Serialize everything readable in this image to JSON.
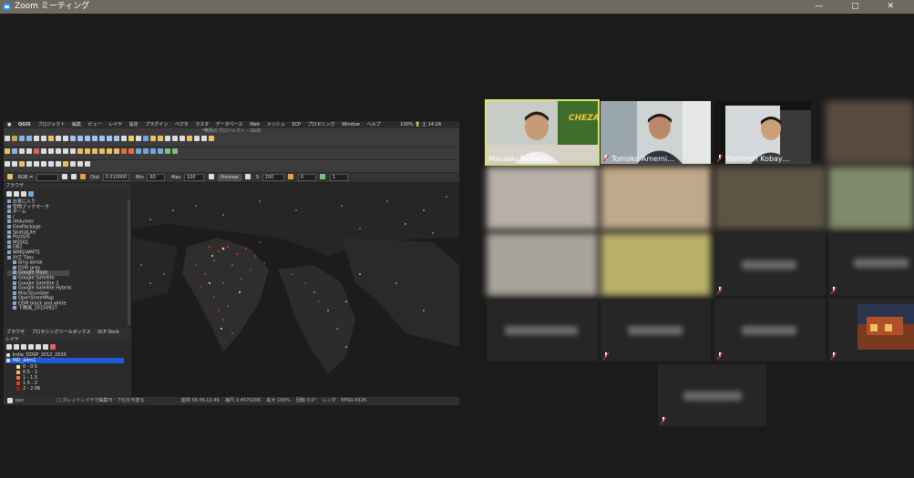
{
  "window": {
    "title": "Zoom ミーティング",
    "buttons": "— ▢ ✕"
  },
  "qgis": {
    "menu": [
      "QGIS",
      "プロジェクト",
      "編集",
      "ビュー",
      "レイヤ",
      "設定",
      "プラグイン",
      "ベクタ",
      "ラスタ",
      "データベース",
      "Web",
      "メッシュ",
      "SCP",
      "プロセシング",
      "Window",
      "ヘルプ"
    ],
    "status_right": "100% 🔋 土 14:24",
    "title": "*無題のプロジェクト - QGIS",
    "params": {
      "rgb": "RGB =",
      "dist_label": "Dist",
      "dist_value": "0.010000",
      "min_label": "Min",
      "min_value": "60",
      "max_label": "Max",
      "max_value": "100",
      "preview": "Preview",
      "s_value": "200",
      "v1": "0",
      "v2": "1"
    },
    "browser": {
      "header": "ブラウザ",
      "items": [
        "お気に入り",
        "空間ブックマーク",
        "ホーム",
        "/",
        "/Volumes",
        "GeoPackage",
        "SpatiaLite",
        "PostGIS",
        "MSSQL",
        "DB2",
        "WMS/WMTS",
        "XYZ Tiles",
        "bing aerial",
        "ESRI gray",
        "Google Maps",
        "Google Satellite",
        "Google Satellite 2",
        "Google Satellite Hybrid",
        "MiscStumbler",
        "OpenStreetMap",
        "OSM black and white",
        "下層画_20150927"
      ],
      "selected_index": 14
    },
    "tabs": [
      "ブラウザ",
      "プロセシングツールボックス",
      "SCP Dock"
    ],
    "layers": {
      "header": "レイヤ",
      "items": [
        "India_DDSP_2012_2020",
        "IND_adm1"
      ],
      "selected_index": 1,
      "legend": [
        {
          "label": "0 - 0.5",
          "color": "#f5e6a0"
        },
        {
          "label": "0.5 - 1",
          "color": "#f4b860"
        },
        {
          "label": "1 - 1.5",
          "color": "#ec7a40"
        },
        {
          "label": "1.5 - 2",
          "color": "#d94020"
        },
        {
          "label": "2 - 2.06",
          "color": "#b81010"
        }
      ]
    },
    "statusbar": {
      "search": "pan",
      "hint": "□ カレントレイヤで編集可・下位を可変る",
      "coord_label": "座標",
      "coord_value": "58.56,12.49",
      "scale_label": "縮尺",
      "scale_value": "1:4570266",
      "magnify_label": "拡大",
      "magnify_value": "100%",
      "rotation_label": "回転",
      "rotation_value": "0.0°",
      "render": "レンダ",
      "crs": "EPSG:4326"
    }
  },
  "participants": [
    {
      "name": "Masaaki Nakarai",
      "visible": true,
      "active": true,
      "muted": false
    },
    {
      "name": "Tomoko Amemi…",
      "visible": true,
      "active": false,
      "muted": true
    },
    {
      "name": "Yoshinori Kobay…",
      "visible": true,
      "active": false,
      "muted": true
    },
    {
      "name": "",
      "visible": false,
      "muted": true
    },
    {
      "name": "",
      "visible": false,
      "muted": true
    },
    {
      "name": "",
      "visible": false,
      "muted": true
    },
    {
      "name": "",
      "visible": false,
      "muted": true
    },
    {
      "name": "",
      "visible": false,
      "muted": true
    },
    {
      "name": "",
      "visible": false,
      "muted": true
    },
    {
      "name": "",
      "visible": false,
      "muted": true
    },
    {
      "name": "",
      "visible": false,
      "muted": true
    },
    {
      "name": "",
      "visible": false,
      "muted": true
    },
    {
      "name": "",
      "visible": false,
      "muted": true
    },
    {
      "name": "",
      "visible": false,
      "muted": true
    },
    {
      "name": "",
      "visible": false,
      "muted": true
    },
    {
      "name": "",
      "visible": false,
      "muted": true
    },
    {
      "name": "",
      "visible": false,
      "muted": true
    }
  ],
  "banner_text": "CHEZA",
  "colors": {
    "accent_active": "#d9e46f",
    "muted_red": "#e0362c",
    "qgis_select": "#1d5bd8"
  }
}
